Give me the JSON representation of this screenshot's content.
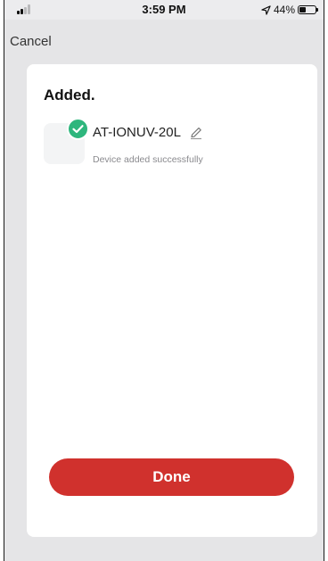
{
  "status_bar": {
    "time": "3:59 PM",
    "battery_percent": "44%",
    "battery_level": 0.44,
    "signal_bars_active": 2,
    "signal_bars_total": 4,
    "icons": [
      "signal-icon",
      "location-arrow-icon",
      "battery-icon"
    ]
  },
  "header": {
    "cancel_label": "Cancel"
  },
  "card": {
    "title": "Added.",
    "device": {
      "name": "AT-IONUV-20L",
      "status": "Device added successfully",
      "icons": [
        "check-icon",
        "pencil-edit-icon"
      ]
    },
    "done_label": "Done"
  },
  "colors": {
    "accent": "#d0312d",
    "success": "#2eb67d",
    "background": "#e5e5e7",
    "card": "#ffffff"
  }
}
